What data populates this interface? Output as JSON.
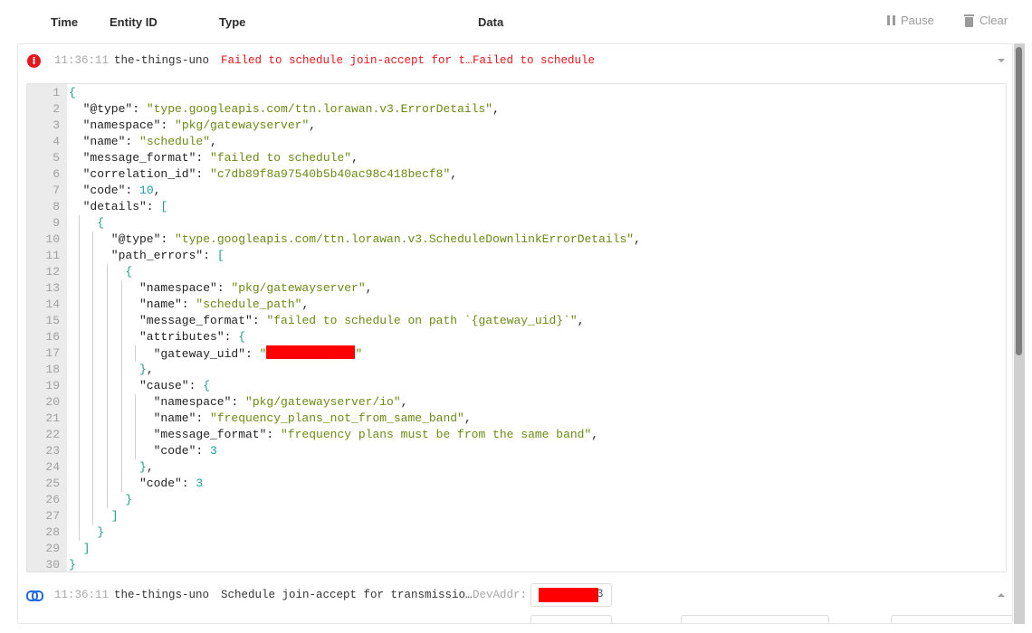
{
  "header": {
    "columns": {
      "time": "Time",
      "entity_id": "Entity ID",
      "type": "Type",
      "data": "Data"
    },
    "pause_label": "Pause",
    "clear_label": "Clear"
  },
  "events": [
    {
      "icon": "error-icon",
      "time": "11:36:11",
      "entity_id": "the-things-uno",
      "type": "Failed to schedule join-accept for t…",
      "data": "Failed to schedule",
      "expanded": true,
      "status_color": "#e8151b"
    },
    {
      "icon": "link-icon",
      "time": "11:36:11",
      "entity_id": "the-things-uno",
      "type": "Schedule join-accept for transmissio…",
      "data_label": "DevAddr:",
      "data_value_suffix": "3",
      "expanded": false
    }
  ],
  "json_lines": [
    {
      "n": "1",
      "depth": 0,
      "parts": [
        [
          "b",
          "{"
        ]
      ]
    },
    {
      "n": "2",
      "depth": 1,
      "parts": [
        [
          "k",
          "\"@type\": "
        ],
        [
          "s",
          "\"type.googleapis.com/ttn.lorawan.v3.ErrorDetails\""
        ],
        [
          "k",
          ","
        ]
      ]
    },
    {
      "n": "3",
      "depth": 1,
      "parts": [
        [
          "k",
          "\"namespace\": "
        ],
        [
          "s",
          "\"pkg/gatewayserver\""
        ],
        [
          "k",
          ","
        ]
      ]
    },
    {
      "n": "4",
      "depth": 1,
      "parts": [
        [
          "k",
          "\"name\": "
        ],
        [
          "s",
          "\"schedule\""
        ],
        [
          "k",
          ","
        ]
      ]
    },
    {
      "n": "5",
      "depth": 1,
      "parts": [
        [
          "k",
          "\"message_format\": "
        ],
        [
          "s",
          "\"failed to schedule\""
        ],
        [
          "k",
          ","
        ]
      ]
    },
    {
      "n": "6",
      "depth": 1,
      "parts": [
        [
          "k",
          "\"correlation_id\": "
        ],
        [
          "s",
          "\"c7db89f8a97540b5b40ac98c418becf8\""
        ],
        [
          "k",
          ","
        ]
      ]
    },
    {
      "n": "7",
      "depth": 1,
      "parts": [
        [
          "k",
          "\"code\": "
        ],
        [
          "n",
          "10"
        ],
        [
          "k",
          ","
        ]
      ]
    },
    {
      "n": "8",
      "depth": 1,
      "parts": [
        [
          "k",
          "\"details\": "
        ],
        [
          "b",
          "["
        ]
      ]
    },
    {
      "n": "9",
      "depth": 2,
      "parts": [
        [
          "b",
          "{"
        ]
      ]
    },
    {
      "n": "10",
      "depth": 3,
      "parts": [
        [
          "k",
          "\"@type\": "
        ],
        [
          "s",
          "\"type.googleapis.com/ttn.lorawan.v3.ScheduleDownlinkErrorDetails\""
        ],
        [
          "k",
          ","
        ]
      ]
    },
    {
      "n": "11",
      "depth": 3,
      "parts": [
        [
          "k",
          "\"path_errors\": "
        ],
        [
          "b",
          "["
        ]
      ]
    },
    {
      "n": "12",
      "depth": 4,
      "parts": [
        [
          "b",
          "{"
        ]
      ]
    },
    {
      "n": "13",
      "depth": 5,
      "parts": [
        [
          "k",
          "\"namespace\": "
        ],
        [
          "s",
          "\"pkg/gatewayserver\""
        ],
        [
          "k",
          ","
        ]
      ]
    },
    {
      "n": "14",
      "depth": 5,
      "parts": [
        [
          "k",
          "\"name\": "
        ],
        [
          "s",
          "\"schedule_path\""
        ],
        [
          "k",
          ","
        ]
      ]
    },
    {
      "n": "15",
      "depth": 5,
      "parts": [
        [
          "k",
          "\"message_format\": "
        ],
        [
          "s",
          "\"failed to schedule on path `{gateway_uid}`\""
        ],
        [
          "k",
          ","
        ]
      ]
    },
    {
      "n": "16",
      "depth": 5,
      "parts": [
        [
          "k",
          "\"attributes\": "
        ],
        [
          "b",
          "{"
        ]
      ]
    },
    {
      "n": "17",
      "depth": 6,
      "parts": [
        [
          "k",
          "\"gateway_uid\": "
        ],
        [
          "s",
          "\""
        ],
        [
          "r",
          ""
        ],
        [
          "s",
          "\""
        ]
      ]
    },
    {
      "n": "18",
      "depth": 5,
      "parts": [
        [
          "b",
          "}"
        ],
        [
          "k",
          ","
        ]
      ]
    },
    {
      "n": "19",
      "depth": 5,
      "parts": [
        [
          "k",
          "\"cause\": "
        ],
        [
          "b",
          "{"
        ]
      ]
    },
    {
      "n": "20",
      "depth": 6,
      "parts": [
        [
          "k",
          "\"namespace\": "
        ],
        [
          "s",
          "\"pkg/gatewayserver/io\""
        ],
        [
          "k",
          ","
        ]
      ]
    },
    {
      "n": "21",
      "depth": 6,
      "parts": [
        [
          "k",
          "\"name\": "
        ],
        [
          "s",
          "\"frequency_plans_not_from_same_band\""
        ],
        [
          "k",
          ","
        ]
      ]
    },
    {
      "n": "22",
      "depth": 6,
      "parts": [
        [
          "k",
          "\"message_format\": "
        ],
        [
          "s",
          "\"frequency plans must be from the same band\""
        ],
        [
          "k",
          ","
        ]
      ]
    },
    {
      "n": "23",
      "depth": 6,
      "parts": [
        [
          "k",
          "\"code\": "
        ],
        [
          "n",
          "3"
        ]
      ]
    },
    {
      "n": "24",
      "depth": 5,
      "parts": [
        [
          "b",
          "}"
        ],
        [
          "k",
          ","
        ]
      ]
    },
    {
      "n": "25",
      "depth": 5,
      "parts": [
        [
          "k",
          "\"code\": "
        ],
        [
          "n",
          "3"
        ]
      ]
    },
    {
      "n": "26",
      "depth": 4,
      "parts": [
        [
          "b",
          "}"
        ]
      ]
    },
    {
      "n": "27",
      "depth": 3,
      "parts": [
        [
          "b",
          "]"
        ]
      ]
    },
    {
      "n": "28",
      "depth": 2,
      "parts": [
        [
          "b",
          "}"
        ]
      ]
    },
    {
      "n": "29",
      "depth": 1,
      "parts": [
        [
          "b",
          "]"
        ]
      ]
    },
    {
      "n": "30",
      "depth": 0,
      "parts": [
        [
          "b",
          "}"
        ]
      ]
    }
  ]
}
